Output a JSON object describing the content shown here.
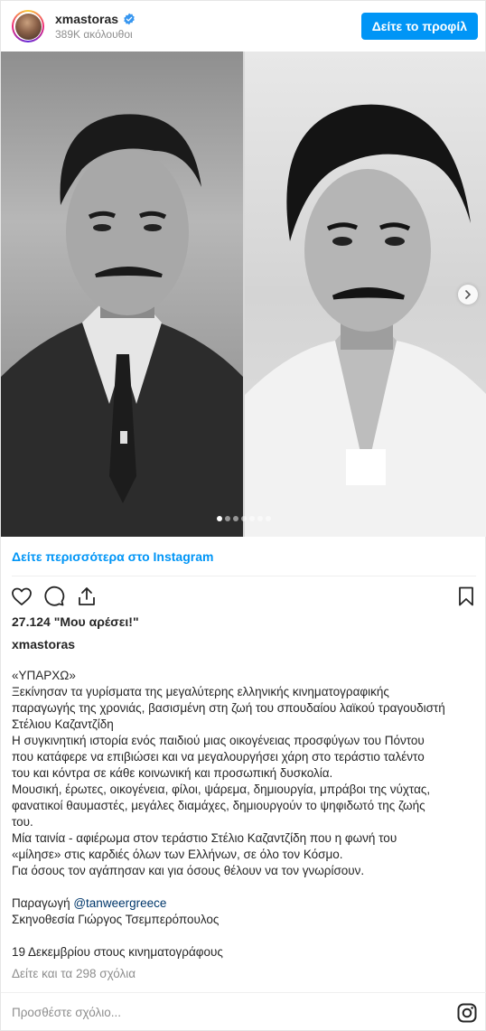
{
  "header": {
    "username": "xmastoras",
    "followers": "389K ακόλουθοι",
    "view_profile_label": "Δείτε το προφίλ"
  },
  "media": {
    "dots_total": 7,
    "dot_active_index": 0
  },
  "more_link": "Δείτε περισσότερα στο Instagram",
  "likes": "27.124 \"Μου αρέσει!\"",
  "author": "xmastoras",
  "caption": {
    "lines": [
      "«ΥΠΑΡΧΩ»",
      "Ξεκίνησαν τα γυρίσματα της μεγαλύτερης ελληνικής κινηματογραφικής",
      "παραγωγής της χρονιάς, βασισμένη στη ζωή του σπουδαίου λαϊκού τραγουδιστή",
      "Στέλιου Καζαντζίδη",
      "Η συγκινητική ιστορία ενός παιδιού μιας οικογένειας προσφύγων του Πόντου",
      "που κατάφερε να επιβιώσει και να μεγαλουργήσει χάρη στο τεράστιο ταλέντο",
      "του και κόντρα σε κάθε κοινωνική και προσωπική δυσκολία.",
      "Μουσική, έρωτες, οικογένεια, φίλοι, ψάρεμα, δημιουργία, μπράβοι της νύχτας,",
      "φανατικοί θαυμαστές, μεγάλες διαμάχες, δημιουργούν το ψηφιδωτό της ζωής",
      "του.",
      "Μία ταινία - αφιέρωμα στον τεράστιο Στέλιο Καζαντζίδη που η φωνή του",
      "«μίλησε» στις καρδιές όλων των Ελλήνων, σε όλο τον Κόσμο.",
      "Για όσους τον αγάπησαν και για όσους θέλουν να τον γνωρίσουν."
    ],
    "production_prefix": "Παραγωγή ",
    "production_mention": "@tanweergreece",
    "direction": "Σκηνοθεσία Γιώργος Τσεμπερόπουλος",
    "release": "19 Δεκεμβρίου στους κινηματογράφους"
  },
  "comments_link": "Δείτε και τα 298 σχόλια",
  "add_comment_placeholder": "Προσθέστε σχόλιο...",
  "colors": {
    "accent": "#0095f6",
    "text": "#262626",
    "muted": "#8e8e8e"
  },
  "icons": {
    "verified": "verified-badge-icon",
    "like": "heart-icon",
    "comment": "comment-icon",
    "share": "share-icon",
    "save": "bookmark-icon",
    "next": "chevron-right-icon",
    "brand": "instagram-icon"
  }
}
